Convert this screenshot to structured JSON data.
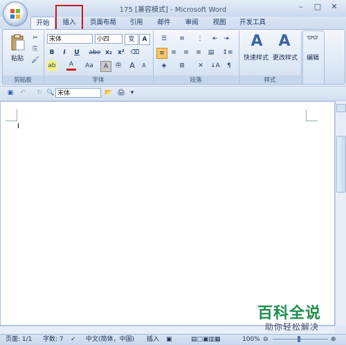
{
  "window": {
    "title": "175 [兼容模式] - Microsoft Word",
    "minimize": "–",
    "maximize": "□",
    "close": "✕"
  },
  "tabs": [
    {
      "label": "开始",
      "active": true
    },
    {
      "label": "插入",
      "active": false,
      "highlighted": true
    },
    {
      "label": "页面布局",
      "active": false
    },
    {
      "label": "引用",
      "active": false
    },
    {
      "label": "邮件",
      "active": false
    },
    {
      "label": "审阅",
      "active": false
    },
    {
      "label": "视图",
      "active": false
    },
    {
      "label": "开发工具",
      "active": false
    }
  ],
  "ribbon": {
    "clipboard": {
      "label": "剪贴板",
      "paste": "粘贴"
    },
    "font": {
      "label": "字体",
      "font_name": "宋体",
      "font_size": "小四",
      "bold": "B",
      "italic": "I",
      "underline": "U",
      "strike": "abe",
      "subscript": "x₂",
      "superscript": "x²",
      "grow": "A",
      "shrink": "A",
      "case": "Aa"
    },
    "paragraph": {
      "label": "段落"
    },
    "styles": {
      "label": "样式",
      "quick_styles": "快速样式",
      "change_styles": "更改样式"
    },
    "editing": {
      "label": "编辑",
      "btn": "编辑"
    }
  },
  "qat": {
    "font_name": "宋体"
  },
  "status": {
    "page": "页面: 1/1",
    "words": "字数: 7",
    "language": "中文(简体，中国)",
    "mode": "插入",
    "zoom": "100%"
  },
  "watermark": {
    "line1": "百科全说",
    "line2": "助你轻松解决"
  },
  "colors": {
    "highlight": "#c01818",
    "accent": "#1d8f4a",
    "ribbon": "#dce7f5"
  }
}
